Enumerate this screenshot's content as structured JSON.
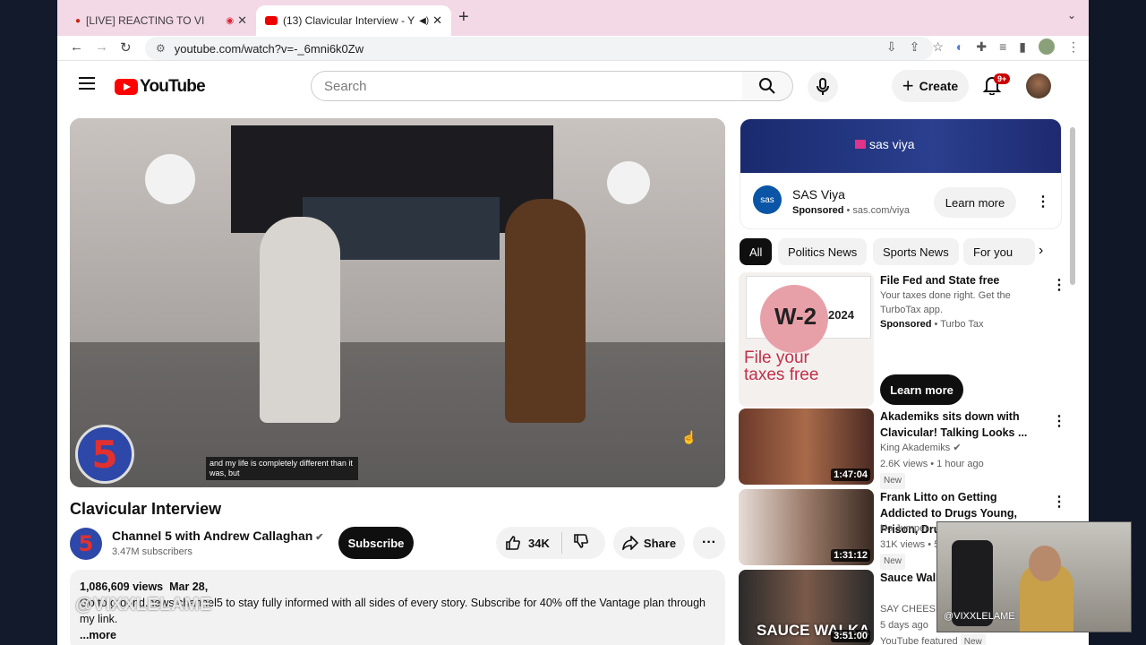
{
  "browser": {
    "tabs": [
      {
        "label": "[LIVE] REACTING TO VI"
      },
      {
        "label": "(13) Clavicular Interview - Y"
      }
    ],
    "url": "youtube.com/watch?v=-_6mni6k0Zw"
  },
  "yt": {
    "logo_text": "YouTube",
    "search_placeholder": "Search",
    "create_label": "Create",
    "notif_count": "9+"
  },
  "video": {
    "caption": "and my life is completely different than it was, but",
    "title": "Clavicular Interview",
    "channel_name": "Channel 5 with Andrew Callaghan",
    "channel_initial": "5",
    "subscribers": "3.47M subscribers",
    "subscribe_label": "Subscribe",
    "likes": "34K",
    "share_label": "Share",
    "views": "1,086,609 views",
    "date": "Mar 28,",
    "description": "Go to ground.news/channel5 to stay fully informed with all sides of every story. Subscribe for 40% off the Vantage plan through my link.",
    "more_label": "...more"
  },
  "ad": {
    "banner_text": "sas viya",
    "logo_text": "sas",
    "name": "SAS Viya",
    "sponsored": "Sponsored",
    "domain": "sas.com/viya",
    "cta": "Learn more"
  },
  "chips": [
    "All",
    "Politics News",
    "Sports News",
    "For you"
  ],
  "recommendations": [
    {
      "title": "File Fed and State free",
      "line1": "Your taxes done right. Get the",
      "line2": "TurboTax app.",
      "sponsored": "Sponsored",
      "advertiser": "Turbo Tax",
      "cta": "Learn more",
      "thumb_text": "W-2",
      "thumb_year": "2024",
      "thumb_caption": "File your taxes free"
    },
    {
      "title": "Akademiks sits down with Clavicular! Talking Looks ...",
      "channel": "King Akademiks",
      "meta": "2.6K views • 1 hour ago",
      "badge": "New",
      "duration": "1:47:04"
    },
    {
      "title": "Frank Litto on Getting Addicted to Drugs Young, Prison, Druski...",
      "channel": "No Jumper",
      "meta": "31K views • 5",
      "badge": "New",
      "duration": "1:31:12"
    },
    {
      "title": "Sauce Walk EVERYTHIN",
      "channel": "SAY CHEESE",
      "meta": "5 days ago",
      "badge": "New",
      "extra": "YouTube featured",
      "duration": "3:51:00",
      "thumb_text": "SAUCE WALKA"
    }
  ],
  "overlay": {
    "watermark": "@VIXXLELAME"
  }
}
